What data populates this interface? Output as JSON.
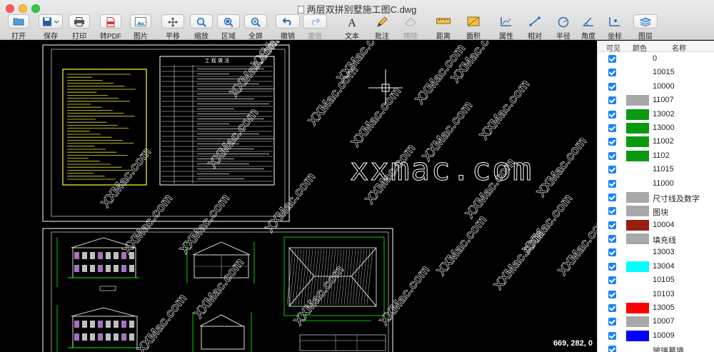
{
  "window": {
    "title": "两层双拼别墅施工图C.dwg"
  },
  "toolbar": {
    "open": "打开",
    "save": "保存",
    "print": "打印",
    "to_pdf": "转PDF",
    "image": "图片",
    "pan": "平移",
    "zoom": "缩放",
    "zoom_window": "区域",
    "full_view": "全屏",
    "undo": "撤销",
    "redo": "重做",
    "text": "文本",
    "annotate": "批注",
    "erase": "擦除",
    "distance": "距离",
    "area": "面积",
    "properties": "属性",
    "relative": "相对",
    "radius": "半径",
    "angle": "角度",
    "coordinate": "坐标",
    "layers": "图层"
  },
  "canvas": {
    "coordinates": "669, 282, 0",
    "watermark_big": "xxmac.com",
    "watermark_small": "XXMac.com",
    "sheet_title": "工 程 做 法"
  },
  "layer_panel": {
    "headers": {
      "visible": "可见",
      "color": "颜色",
      "name": "名称"
    },
    "layers": [
      {
        "name": "0",
        "color": "#ffffff"
      },
      {
        "name": "10015",
        "color": "#ffffff"
      },
      {
        "name": "10000",
        "color": "#ffffff"
      },
      {
        "name": "11007",
        "color": "#a8a8a8"
      },
      {
        "name": "13002",
        "color": "#0a9a10"
      },
      {
        "name": "13000",
        "color": "#0a9a10"
      },
      {
        "name": "11002",
        "color": "#0a9a10"
      },
      {
        "name": "1102",
        "color": "#0a9a10"
      },
      {
        "name": "11015",
        "color": "#ffffff"
      },
      {
        "name": "11000",
        "color": "#ffffff"
      },
      {
        "name": "尺寸线及数字",
        "color": "#a8a8a8"
      },
      {
        "name": "图块",
        "color": "#a8a8a8"
      },
      {
        "name": "10004",
        "color": "#9a1d12"
      },
      {
        "name": "填充线",
        "color": "#a8a8a8"
      },
      {
        "name": "13003",
        "color": "#ffffff"
      },
      {
        "name": "13004",
        "color": "#00ffff"
      },
      {
        "name": "10105",
        "color": "#ffffff"
      },
      {
        "name": "10103",
        "color": "#ffffff"
      },
      {
        "name": "13005",
        "color": "#ff0000"
      },
      {
        "name": "10007",
        "color": "#a8a8a8"
      },
      {
        "name": "10009",
        "color": "#0000ff"
      },
      {
        "name": "玻璃幕墙",
        "color": "#ffffff"
      }
    ]
  }
}
